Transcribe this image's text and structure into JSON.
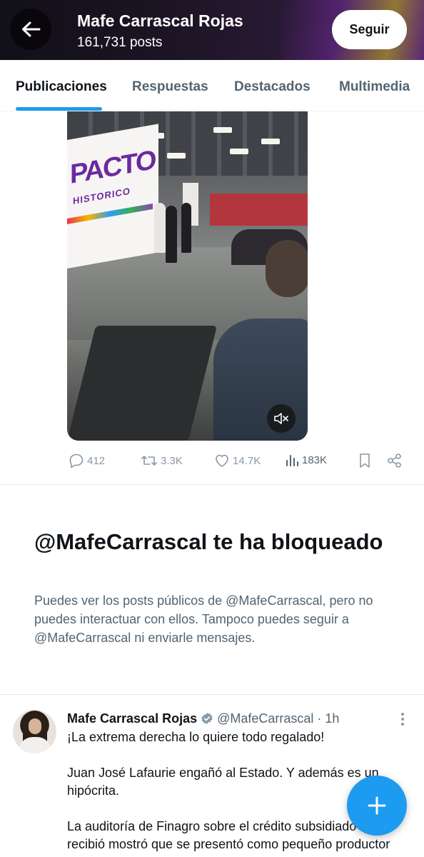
{
  "header": {
    "name": "Mafe Carrascal Rojas",
    "posts_count": "161,731 posts",
    "follow_label": "Seguir",
    "back_icon": "arrow-left-icon"
  },
  "tabs": [
    {
      "label": "Publicaciones",
      "active": true
    },
    {
      "label": "Respuestas",
      "active": false
    },
    {
      "label": "Destacados",
      "active": false
    },
    {
      "label": "Multimedia",
      "active": false
    }
  ],
  "media": {
    "screen_text": "PACTO",
    "screen_subtext": "HISTORICO",
    "mute_icon": "speaker-muted-icon"
  },
  "actions": {
    "replies": "412",
    "reposts": "3.3K",
    "likes": "14.7K",
    "views": "183K"
  },
  "blocked": {
    "title": "@MafeCarrascal te ha bloqueado",
    "description": "Puedes ver los posts públicos de @MafeCarrascal, pero no puedes interactuar con ellos. Tampoco puedes seguir a @MafeCarrascal ni enviarle mensajes."
  },
  "post": {
    "author_name": "Mafe Carrascal Rojas",
    "handle": "@MafeCarrascal",
    "separator": "·",
    "time": "1h",
    "paragraphs": [
      "¡La extrema derecha lo quiere todo regalado!",
      "Juan José Lafaurie engañó al Estado. Y además es un hipócrita.",
      "La auditoría de Finagro sobre el crédito subsidiado que recibió mostró que se presentó como pequeño productor"
    ]
  },
  "colors": {
    "accent": "#1d9bf0",
    "text_primary": "#0f1419",
    "text_secondary": "#536471"
  }
}
